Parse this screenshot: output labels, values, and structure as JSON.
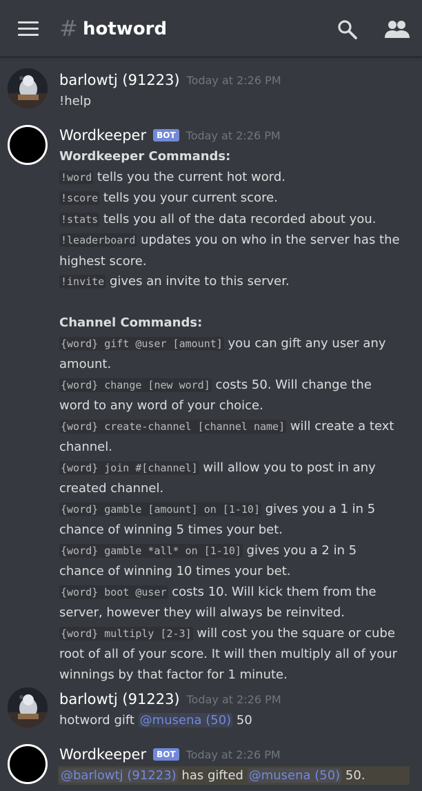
{
  "header": {
    "hash": "#",
    "channel": "hotword"
  },
  "messages": [
    {
      "author": "barlowtj (91223)",
      "timestamp": "Today at 2:26 PM",
      "text": "!help"
    },
    {
      "author": "Wordkeeper",
      "bot_tag": "BOT",
      "timestamp": "Today at 2:26 PM",
      "heading1": "Wordkeeper Commands:",
      "commands": [
        {
          "code": "!word",
          "text": " tells you the current hot word."
        },
        {
          "code": "!score",
          "text": " tells you your current score."
        },
        {
          "code": "!stats",
          "text": " tells you all of the data recorded about you."
        },
        {
          "code": "!leaderboard",
          "text": " updates you on who in the server has the highest score."
        },
        {
          "code": "!invite",
          "text": " gives an invite to this server."
        }
      ],
      "heading2": "Channel Commands:",
      "channel_commands": [
        {
          "code": "{word} gift @user [amount]",
          "text": " you can gift any user any amount."
        },
        {
          "code": "{word} change [new word]",
          "text": " costs 50. Will change the word to any word of your choice."
        },
        {
          "code": "{word} create-channel [channel name]",
          "text": " will create a text channel."
        },
        {
          "code": "{word} join #[channel]",
          "text": " will allow you to post in any created channel."
        },
        {
          "code": "{word} gamble [amount] on [1-10]",
          "text": " gives you a 1 in 5 chance of winning 5 times your bet."
        },
        {
          "code": "{word} gamble *all* on [1-10]",
          "text": " gives you a 2 in 5 chance of winning 10 times your bet."
        },
        {
          "code": "{word} boot @user",
          "text": " costs 10. Will kick them from the server, however they will always be reinvited."
        },
        {
          "code": "{word} multiply [2-3]",
          "text": " will cost you the square or cube root of all of your score. It will then multiply all of your winnings by that factor for 1 minute."
        }
      ]
    },
    {
      "author": "barlowtj (91223)",
      "timestamp": "Today at 2:26 PM",
      "text_before": "hotword gift ",
      "mention": "@musena (50)",
      "text_after": " 50"
    },
    {
      "author": "Wordkeeper",
      "bot_tag": "BOT",
      "timestamp": "Today at 2:26 PM",
      "mention1": "@barlowtj (91223)",
      "middle": " has gifted ",
      "mention2": "@musena (50)",
      "text_after": " 50."
    }
  ],
  "icons": {
    "menu": "hamburger-menu-icon",
    "search": "search-icon",
    "members": "members-icon"
  },
  "colors": {
    "background": "#36393f",
    "bot_tag": "#7289da",
    "mention": "#7289da",
    "timestamp": "#72767d"
  }
}
